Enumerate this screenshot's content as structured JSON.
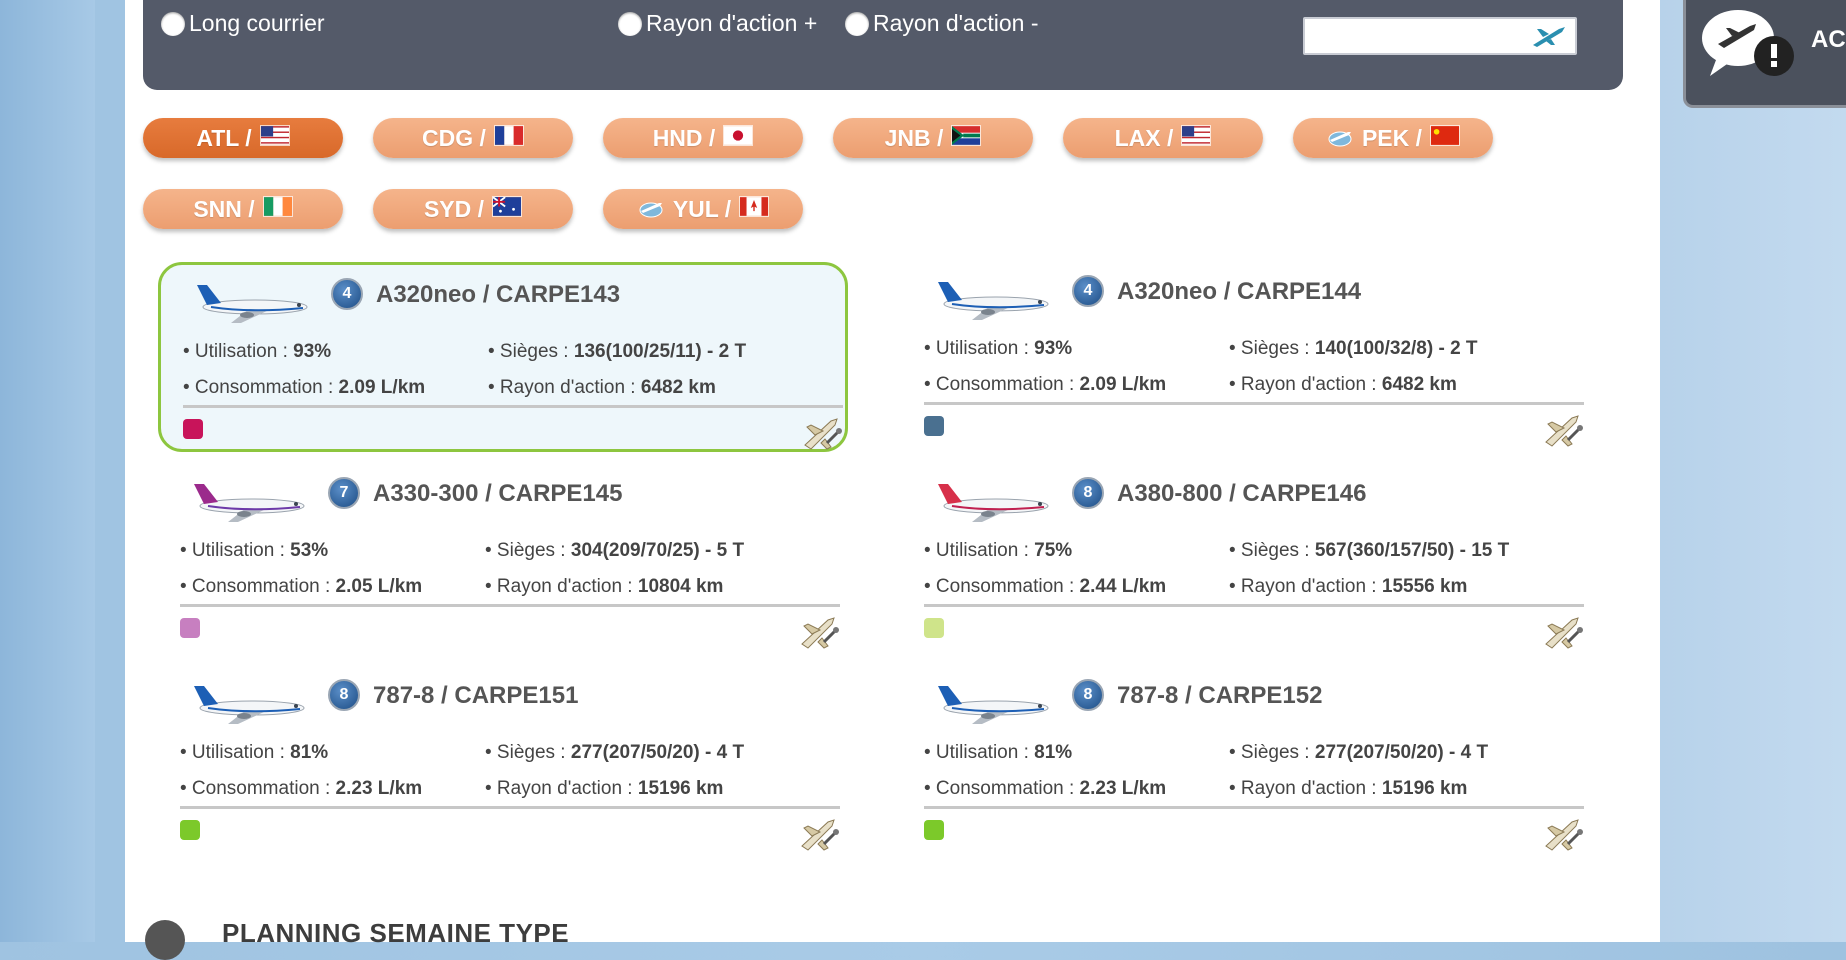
{
  "filters": {
    "radios": [
      {
        "label": "Long courrier"
      },
      {
        "label": "Rayon d'action +"
      },
      {
        "label": "Rayon d'action -"
      }
    ],
    "search": {
      "value": "",
      "placeholder": ""
    }
  },
  "notification": {
    "label": "ACC"
  },
  "airports": [
    {
      "code": "ATL /",
      "flag": "us",
      "active": true,
      "globe": false
    },
    {
      "code": "CDG /",
      "flag": "fr",
      "active": false,
      "globe": false
    },
    {
      "code": "HND /",
      "flag": "jp",
      "active": false,
      "globe": false
    },
    {
      "code": "JNB /",
      "flag": "za",
      "active": false,
      "globe": false
    },
    {
      "code": "LAX /",
      "flag": "us",
      "active": false,
      "globe": false
    },
    {
      "code": "PEK /",
      "flag": "cn",
      "active": false,
      "globe": true
    },
    {
      "code": "SNN /",
      "flag": "ie",
      "active": false,
      "globe": false
    },
    {
      "code": "SYD /",
      "flag": "au",
      "active": false,
      "globe": false
    },
    {
      "code": "YUL /",
      "flag": "ca",
      "active": false,
      "globe": true
    }
  ],
  "labels": {
    "utilisation": "• Utilisation : ",
    "sieges": "• Sièges : ",
    "consommation": "• Consommation : ",
    "rayon": "• Rayon d'action : "
  },
  "aircraft": [
    {
      "title": "A320neo / CARPE143",
      "badge": "4",
      "utilisation": "93%",
      "sieges": "136(100/25/11) - 2 T",
      "consommation": "2.09 L/km",
      "rayon": "6482 km",
      "color": "#c8145a",
      "selected": true,
      "livery": "airbus"
    },
    {
      "title": "A320neo / CARPE144",
      "badge": "4",
      "utilisation": "93%",
      "sieges": "140(100/32/8) - 2 T",
      "consommation": "2.09 L/km",
      "rayon": "6482 km",
      "color": "#4a7090",
      "selected": false,
      "livery": "airbus"
    },
    {
      "title": "A330-300 / CARPE145",
      "badge": "7",
      "utilisation": "53%",
      "sieges": "304(209/70/25) - 5 T",
      "consommation": "2.05 L/km",
      "rayon": "10804 km",
      "color": "#c77fc0",
      "selected": false,
      "livery": "purple"
    },
    {
      "title": "A380-800 / CARPE146",
      "badge": "8",
      "utilisation": "75%",
      "sieges": "567(360/157/50) - 15 T",
      "consommation": "2.44 L/km",
      "rayon": "15556 km",
      "color": "#cfe48a",
      "selected": false,
      "livery": "red"
    },
    {
      "title": "787-8 / CARPE151",
      "badge": "8",
      "utilisation": "81%",
      "sieges": "277(207/50/20) - 4 T",
      "consommation": "2.23 L/km",
      "rayon": "15196 km",
      "color": "#7cc92a",
      "selected": false,
      "livery": "boeing"
    },
    {
      "title": "787-8 / CARPE152",
      "badge": "8",
      "utilisation": "81%",
      "sieges": "277(207/50/20) - 4 T",
      "consommation": "2.23 L/km",
      "rayon": "15196 km",
      "color": "#7cc92a",
      "selected": false,
      "livery": "boeing"
    }
  ],
  "section": {
    "title": "PLANNING SEMAINE TYPE"
  }
}
